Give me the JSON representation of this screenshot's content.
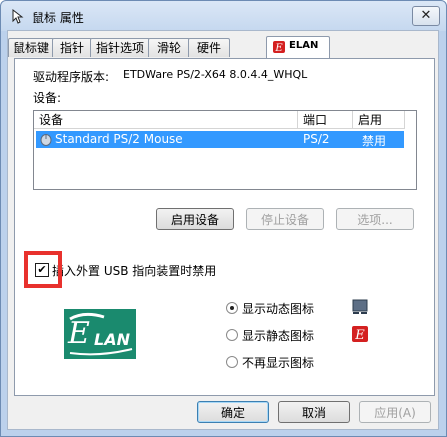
{
  "window": {
    "title": "鼠标 属性",
    "close_glyph": "✕"
  },
  "tabs": [
    "鼠标键",
    "指针",
    "指针选项",
    "滑轮",
    "硬件",
    "ELAN"
  ],
  "driver": {
    "label": "驱动程序版本:",
    "value": "ETDWare PS/2-X64 8.0.4.4_WHQL"
  },
  "devices": {
    "label": "设备:",
    "columns": [
      "设备",
      "端口",
      "启用"
    ],
    "rows": [
      {
        "name": "Standard PS/2 Mouse",
        "port": "PS/2",
        "enabled": "禁用"
      }
    ]
  },
  "device_buttons": {
    "enable": "启用设备",
    "stop": "停止设备",
    "options": "选项..."
  },
  "usb_checkbox": {
    "label": "插入外置 USB 指向装置时禁用",
    "checked": true
  },
  "icon_options": {
    "dynamic": "显示动态图标",
    "static": "显示静态图标",
    "none": "不再显示图标",
    "selected": "dynamic"
  },
  "logo": {
    "text": "LAN"
  },
  "footer": {
    "ok": "确定",
    "cancel": "取消",
    "apply": "应用(A)"
  },
  "colors": {
    "selection": "#3399ff",
    "highlight_box": "#e8312d",
    "elan_brand": "#1a8a6e"
  }
}
